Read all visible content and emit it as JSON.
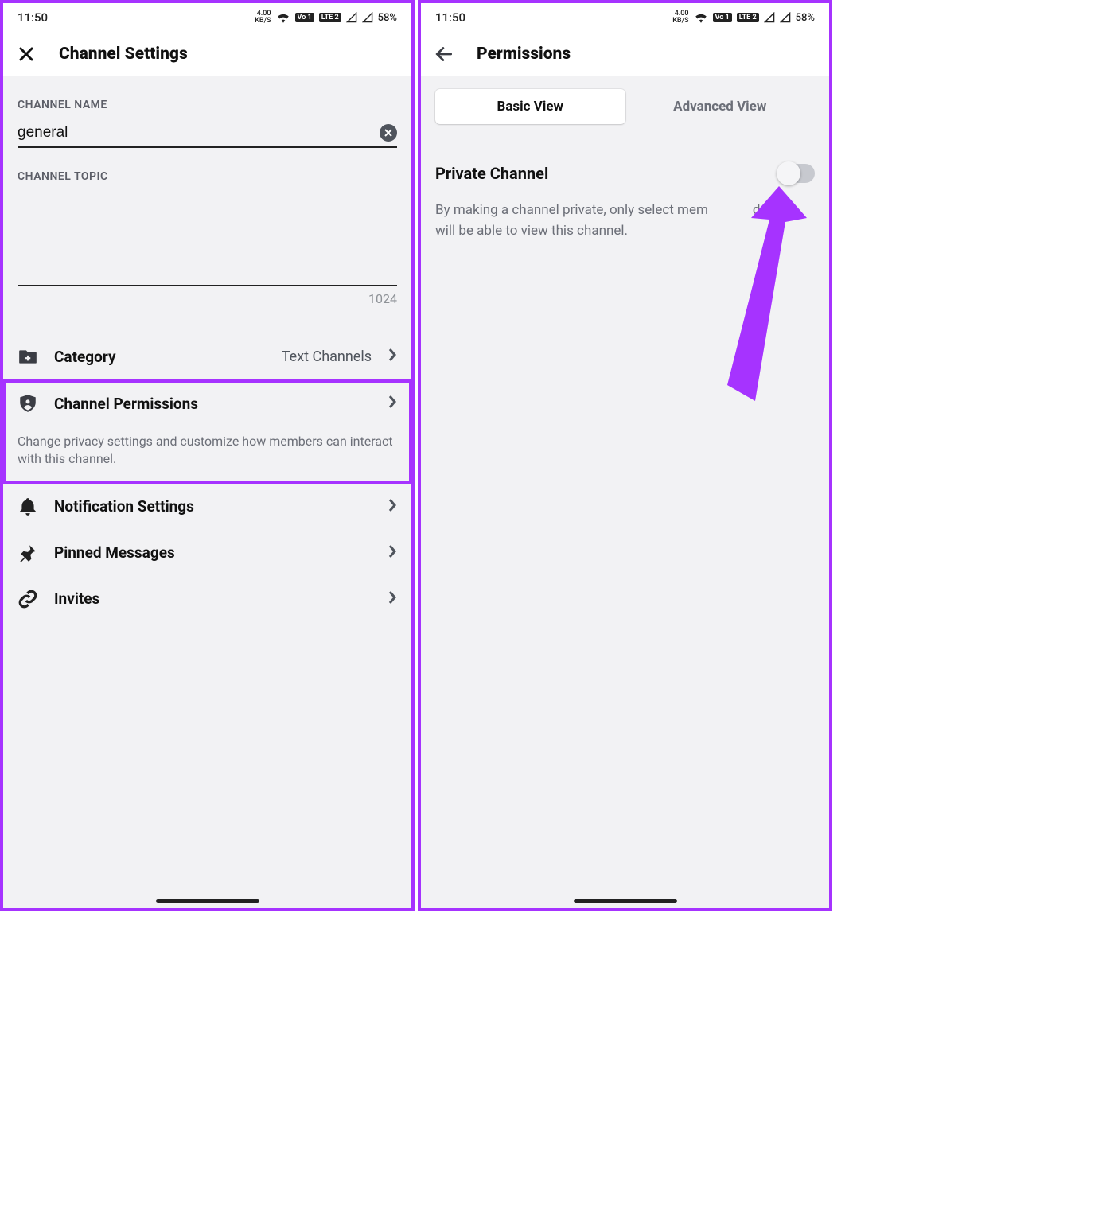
{
  "statusbar": {
    "time": "11:50",
    "kbs_top": "4.00",
    "kbs_bot": "KB/S",
    "lte1": "Vo 1",
    "lte2": "LTE 2",
    "battery": "58%"
  },
  "left": {
    "title": "Channel Settings",
    "section_name": "CHANNEL NAME",
    "name_value": "general",
    "section_topic": "CHANNEL TOPIC",
    "topic_counter": "1024",
    "category_label": "Category",
    "category_value": "Text Channels",
    "perm_label": "Channel Permissions",
    "perm_desc": "Change privacy settings and customize how members can interact with this channel.",
    "notif_label": "Notification Settings",
    "pinned_label": "Pinned Messages",
    "invites_label": "Invites"
  },
  "right": {
    "title": "Permissions",
    "tab_basic": "Basic View",
    "tab_advanced": "Advanced View",
    "private_label": "Private Channel",
    "private_desc_p1": "By making a channel private, only select mem",
    "private_desc_p2": "d roles will be able to view this channel."
  }
}
